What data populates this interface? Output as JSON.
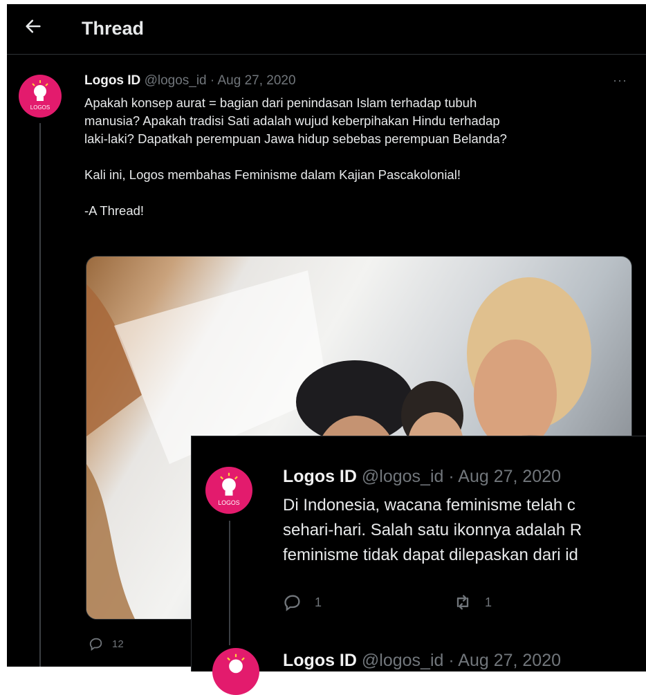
{
  "header": {
    "title": "Thread",
    "back_icon": "arrow-left-icon"
  },
  "tweet": {
    "author": "Logos ID",
    "handle": "@logos_id",
    "date": "Aug 27, 2020",
    "dot": "·",
    "more": "···",
    "text": "Apakah konsep aurat = bagian dari penindasan Islam terhadap tubuh\nmanusia? Apakah tradisi Sati adalah wujud keberpihakan Hindu terhadap\nlaki-laki? Dapatkah perempuan Jawa hidup sebebas perempuan Belanda?\n\nKali ini, Logos membahas Feminisme dalam Kajian Pascakolonial!\n\n-A Thread!",
    "reply_count": "12",
    "avatar_label": "LOGOS"
  },
  "reply_tweet": {
    "author": "Logos ID",
    "handle": "@logos_id",
    "date": "Aug 27, 2020",
    "dot": "·",
    "line1": "Di Indonesia, wacana feminisme telah c",
    "line2": "sehari-hari. Salah satu ikonnya adalah R",
    "line3": "feminisme tidak dapat dilepaskan dari id",
    "reply_count": "1",
    "retweet_count": "1",
    "avatar_label": "LOGOS"
  },
  "next_tweet": {
    "author": "Logos ID",
    "handle": "@logos_id",
    "date": "Aug 27, 2020",
    "dot": "·"
  },
  "colors": {
    "background": "#000000",
    "accent": "#e31b6d",
    "muted": "#71767b",
    "text": "#e7e9ea"
  }
}
